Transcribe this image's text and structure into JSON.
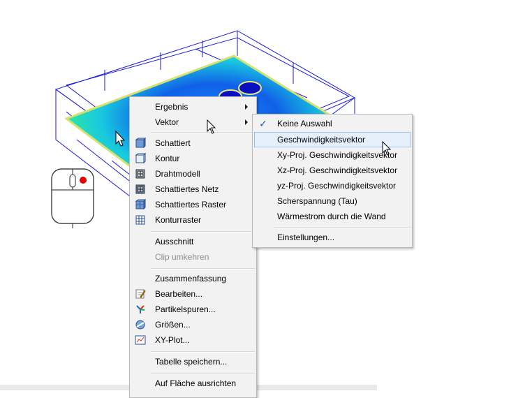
{
  "context_menu": {
    "items": [
      {
        "label": "Ergebnis",
        "has_submenu": true,
        "icon": "none"
      },
      {
        "label": "Vektor",
        "has_submenu": true,
        "icon": "none"
      },
      {
        "label": "Schattiert",
        "icon": "shaded-cube-icon"
      },
      {
        "label": "Kontur",
        "icon": "contour-cube-icon"
      },
      {
        "label": "Drahtmodell",
        "icon": "wireframe-icon"
      },
      {
        "label": "Schattiertes Netz",
        "icon": "shaded-mesh-icon"
      },
      {
        "label": "Schattiertes Raster",
        "icon": "shaded-grid-icon"
      },
      {
        "label": "Konturraster",
        "icon": "contour-grid-icon"
      },
      {
        "label": "Ausschnitt",
        "icon": "none"
      },
      {
        "label": "Clip umkehren",
        "disabled": true,
        "icon": "none"
      },
      {
        "label": "Zusammenfassung",
        "icon": "none"
      },
      {
        "label": "Bearbeiten...",
        "icon": "edit-icon"
      },
      {
        "label": "Partikelspuren...",
        "icon": "particle-traces-icon"
      },
      {
        "label": "Größen...",
        "icon": "quantities-icon"
      },
      {
        "label": "XY-Plot...",
        "icon": "xy-plot-icon"
      },
      {
        "label": "Tabelle speichern...",
        "icon": "none"
      },
      {
        "label": "Auf Fläche ausrichten",
        "icon": "none"
      }
    ]
  },
  "vector_submenu": {
    "items": [
      {
        "label": "Keine Auswahl",
        "checked": true
      },
      {
        "label": "Geschwindigkeitsvektor",
        "highlighted": true
      },
      {
        "label": "Xy-Proj. Geschwindigkeitsvektor"
      },
      {
        "label": "Xz-Proj. Geschwindigkeitsvektor"
      },
      {
        "label": "yz-Proj. Geschwindigkeitsvektor"
      },
      {
        "label": "Scherspannung (Tau)"
      },
      {
        "label": "Wärmestrom durch die Wand"
      },
      {
        "label": "Einstellungen..."
      }
    ]
  },
  "colors": {
    "menu_bg": "#f2f2f2",
    "highlight": "#e5f0fb",
    "wireframe": "#1a1ad6",
    "field_low": "#1020d0",
    "field_high": "#ffff40",
    "mouse_button": "#e00000"
  }
}
